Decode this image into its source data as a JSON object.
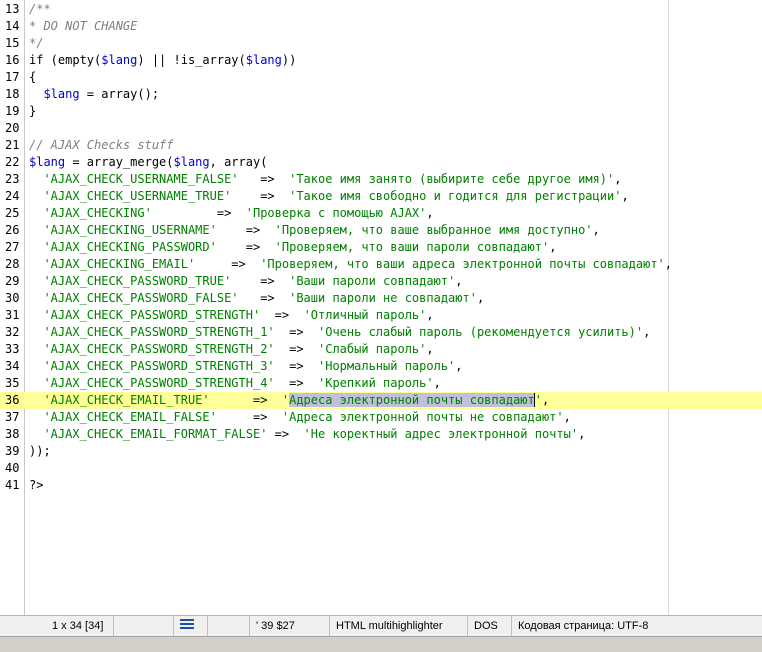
{
  "editor": {
    "lines": [
      {
        "n": "13",
        "parts": [
          [
            "c-comment",
            "/**"
          ]
        ]
      },
      {
        "n": "14",
        "parts": [
          [
            "c-comment",
            "* DO NOT CHANGE"
          ]
        ]
      },
      {
        "n": "15",
        "parts": [
          [
            "c-comment",
            "*/"
          ]
        ]
      },
      {
        "n": "16",
        "parts": [
          [
            "c-kw",
            "if (empty("
          ],
          [
            "c-var",
            "$lang"
          ],
          [
            "c-kw",
            ") || !is_array("
          ],
          [
            "c-var",
            "$lang"
          ],
          [
            "c-kw",
            "))"
          ]
        ]
      },
      {
        "n": "17",
        "parts": [
          [
            "c-op",
            "{"
          ]
        ]
      },
      {
        "n": "18",
        "parts": [
          [
            "c-op",
            "  "
          ],
          [
            "c-var",
            "$lang"
          ],
          [
            "c-op",
            " = array();"
          ]
        ]
      },
      {
        "n": "19",
        "parts": [
          [
            "c-op",
            "}"
          ]
        ]
      },
      {
        "n": "20",
        "parts": []
      },
      {
        "n": "21",
        "parts": [
          [
            "c-comment",
            "// AJAX Checks stuff"
          ]
        ]
      },
      {
        "n": "22",
        "parts": [
          [
            "c-var",
            "$lang"
          ],
          [
            "c-op",
            " = array_merge("
          ],
          [
            "c-var",
            "$lang"
          ],
          [
            "c-op",
            ", array("
          ]
        ]
      },
      {
        "n": "23",
        "parts": [
          [
            "c-op",
            "  "
          ],
          [
            "c-str",
            "'AJAX_CHECK_USERNAME_FALSE'"
          ],
          [
            "c-op",
            "   =>  "
          ],
          [
            "c-str",
            "'Такое имя занято (выбирите себе другое имя)'"
          ],
          [
            "c-op",
            ","
          ]
        ]
      },
      {
        "n": "24",
        "parts": [
          [
            "c-op",
            "  "
          ],
          [
            "c-str",
            "'AJAX_CHECK_USERNAME_TRUE'"
          ],
          [
            "c-op",
            "    =>  "
          ],
          [
            "c-str",
            "'Такое имя свободно и годится для регистрации'"
          ],
          [
            "c-op",
            ","
          ]
        ]
      },
      {
        "n": "25",
        "parts": [
          [
            "c-op",
            "  "
          ],
          [
            "c-str",
            "'AJAX_CHECKING'"
          ],
          [
            "c-op",
            "         =>  "
          ],
          [
            "c-str",
            "'Проверка с помощью AJAX'"
          ],
          [
            "c-op",
            ","
          ]
        ]
      },
      {
        "n": "26",
        "parts": [
          [
            "c-op",
            "  "
          ],
          [
            "c-str",
            "'AJAX_CHECKING_USERNAME'"
          ],
          [
            "c-op",
            "    =>  "
          ],
          [
            "c-str",
            "'Проверяем, что ваше выбранное имя доступно'"
          ],
          [
            "c-op",
            ","
          ]
        ]
      },
      {
        "n": "27",
        "parts": [
          [
            "c-op",
            "  "
          ],
          [
            "c-str",
            "'AJAX_CHECKING_PASSWORD'"
          ],
          [
            "c-op",
            "    =>  "
          ],
          [
            "c-str",
            "'Проверяем, что ваши пароли совпадают'"
          ],
          [
            "c-op",
            ","
          ]
        ]
      },
      {
        "n": "28",
        "parts": [
          [
            "c-op",
            "  "
          ],
          [
            "c-str",
            "'AJAX_CHECKING_EMAIL'"
          ],
          [
            "c-op",
            "     =>  "
          ],
          [
            "c-str",
            "'Проверяем, что ваши адреса электронной почты совпадают'"
          ],
          [
            "c-op",
            ","
          ]
        ]
      },
      {
        "n": "29",
        "parts": [
          [
            "c-op",
            "  "
          ],
          [
            "c-str",
            "'AJAX_CHECK_PASSWORD_TRUE'"
          ],
          [
            "c-op",
            "    =>  "
          ],
          [
            "c-str",
            "'Ваши пароли совпадают'"
          ],
          [
            "c-op",
            ","
          ]
        ]
      },
      {
        "n": "30",
        "parts": [
          [
            "c-op",
            "  "
          ],
          [
            "c-str",
            "'AJAX_CHECK_PASSWORD_FALSE'"
          ],
          [
            "c-op",
            "   =>  "
          ],
          [
            "c-str",
            "'Ваши пароли не совпадают'"
          ],
          [
            "c-op",
            ","
          ]
        ]
      },
      {
        "n": "31",
        "parts": [
          [
            "c-op",
            "  "
          ],
          [
            "c-str",
            "'AJAX_CHECK_PASSWORD_STRENGTH'"
          ],
          [
            "c-op",
            "  =>  "
          ],
          [
            "c-str",
            "'Отличный пароль'"
          ],
          [
            "c-op",
            ","
          ]
        ]
      },
      {
        "n": "32",
        "parts": [
          [
            "c-op",
            "  "
          ],
          [
            "c-str",
            "'AJAX_CHECK_PASSWORD_STRENGTH_1'"
          ],
          [
            "c-op",
            "  =>  "
          ],
          [
            "c-str",
            "'Очень слабый пароль (рекомендуется усилить)'"
          ],
          [
            "c-op",
            ","
          ]
        ]
      },
      {
        "n": "33",
        "parts": [
          [
            "c-op",
            "  "
          ],
          [
            "c-str",
            "'AJAX_CHECK_PASSWORD_STRENGTH_2'"
          ],
          [
            "c-op",
            "  =>  "
          ],
          [
            "c-str",
            "'Слабый пароль'"
          ],
          [
            "c-op",
            ","
          ]
        ]
      },
      {
        "n": "34",
        "parts": [
          [
            "c-op",
            "  "
          ],
          [
            "c-str",
            "'AJAX_CHECK_PASSWORD_STRENGTH_3'"
          ],
          [
            "c-op",
            "  =>  "
          ],
          [
            "c-str",
            "'Нормальный пароль'"
          ],
          [
            "c-op",
            ","
          ]
        ]
      },
      {
        "n": "35",
        "parts": [
          [
            "c-op",
            "  "
          ],
          [
            "c-str",
            "'AJAX_CHECK_PASSWORD_STRENGTH_4'"
          ],
          [
            "c-op",
            "  =>  "
          ],
          [
            "c-str",
            "'Крепкий пароль'"
          ],
          [
            "c-op",
            ","
          ]
        ]
      },
      {
        "n": "36",
        "current": true,
        "parts": [
          [
            "c-op",
            "  "
          ],
          [
            "c-str",
            "'AJAX_CHECK_EMAIL_TRUE'"
          ],
          [
            "c-op",
            "      =>  "
          ],
          [
            "c-str",
            "'"
          ],
          [
            "sel",
            "Адреса электронной почты совпадают"
          ],
          [
            "c-str caret",
            "'"
          ],
          [
            "c-op",
            ","
          ]
        ]
      },
      {
        "n": "37",
        "parts": [
          [
            "c-op",
            "  "
          ],
          [
            "c-str",
            "'AJAX_CHECK_EMAIL_FALSE'"
          ],
          [
            "c-op",
            "     =>  "
          ],
          [
            "c-str",
            "'Адреса электронной почты не совпадают'"
          ],
          [
            "c-op",
            ","
          ]
        ]
      },
      {
        "n": "38",
        "parts": [
          [
            "c-op",
            "  "
          ],
          [
            "c-str",
            "'AJAX_CHECK_EMAIL_FORMAT_FALSE'"
          ],
          [
            "c-op",
            " =>  "
          ],
          [
            "c-str",
            "'Не коректный адрес электронной почты'"
          ],
          [
            "c-op",
            ","
          ]
        ]
      },
      {
        "n": "39",
        "parts": [
          [
            "c-op",
            "));"
          ]
        ]
      },
      {
        "n": "40",
        "parts": []
      },
      {
        "n": "41",
        "parts": [
          [
            "c-op",
            "?>"
          ]
        ]
      }
    ]
  },
  "status": {
    "position": "1 x 34  [34]",
    "selection_marker": "'",
    "counts": "39  $27",
    "syntax": "HTML multihighlighter",
    "line_endings": "DOS",
    "encoding": "Кодовая страница: UTF-8",
    "icon": "align-lines-icon"
  }
}
